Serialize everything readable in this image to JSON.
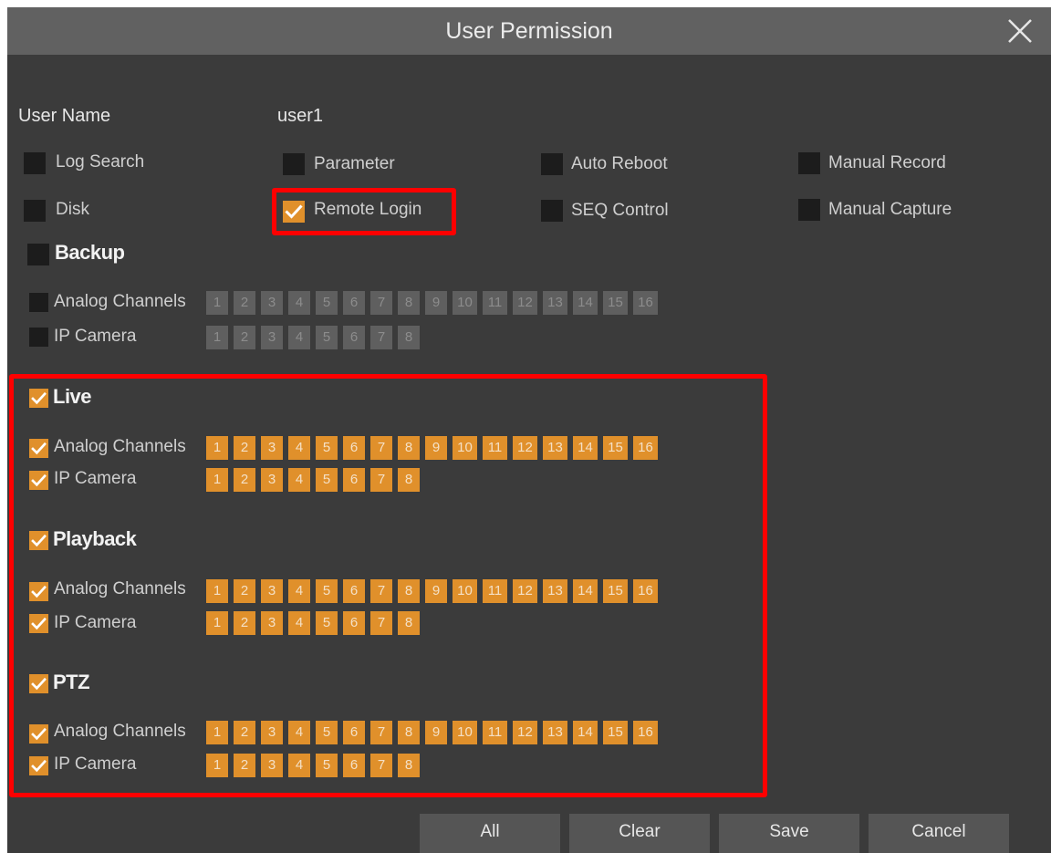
{
  "dialog": {
    "title": "User Permission"
  },
  "user": {
    "label": "User Name",
    "value": "user1"
  },
  "permissions": {
    "log_search": "Log Search",
    "parameter": "Parameter",
    "auto_reboot": "Auto Reboot",
    "manual_record": "Manual Record",
    "disk": "Disk",
    "remote_login": "Remote Login",
    "seq_control": "SEQ Control",
    "manual_capture": "Manual Capture"
  },
  "permission_states": {
    "log_search": false,
    "parameter": false,
    "auto_reboot": false,
    "manual_record": false,
    "disk": false,
    "remote_login": true,
    "seq_control": false,
    "manual_capture": false
  },
  "sections": [
    {
      "title": "Backup",
      "checked": false,
      "rows": [
        {
          "label": "Analog Channels",
          "checked": false,
          "channels": [
            "1",
            "2",
            "3",
            "4",
            "5",
            "6",
            "7",
            "8",
            "9",
            "10",
            "11",
            "12",
            "13",
            "14",
            "15",
            "16"
          ],
          "channels_checked": false
        },
        {
          "label": "IP Camera",
          "checked": false,
          "channels": [
            "1",
            "2",
            "3",
            "4",
            "5",
            "6",
            "7",
            "8"
          ],
          "channels_checked": false
        }
      ]
    },
    {
      "title": "Live",
      "checked": true,
      "rows": [
        {
          "label": "Analog Channels",
          "checked": true,
          "channels": [
            "1",
            "2",
            "3",
            "4",
            "5",
            "6",
            "7",
            "8",
            "9",
            "10",
            "11",
            "12",
            "13",
            "14",
            "15",
            "16"
          ],
          "channels_checked": true
        },
        {
          "label": "IP Camera",
          "checked": true,
          "channels": [
            "1",
            "2",
            "3",
            "4",
            "5",
            "6",
            "7",
            "8"
          ],
          "channels_checked": true
        }
      ]
    },
    {
      "title": "Playback",
      "checked": true,
      "rows": [
        {
          "label": "Analog Channels",
          "checked": true,
          "channels": [
            "1",
            "2",
            "3",
            "4",
            "5",
            "6",
            "7",
            "8",
            "9",
            "10",
            "11",
            "12",
            "13",
            "14",
            "15",
            "16"
          ],
          "channels_checked": true
        },
        {
          "label": "IP Camera",
          "checked": true,
          "channels": [
            "1",
            "2",
            "3",
            "4",
            "5",
            "6",
            "7",
            "8"
          ],
          "channels_checked": true
        }
      ]
    },
    {
      "title": "PTZ",
      "checked": true,
      "rows": [
        {
          "label": "Analog Channels",
          "checked": true,
          "channels": [
            "1",
            "2",
            "3",
            "4",
            "5",
            "6",
            "7",
            "8",
            "9",
            "10",
            "11",
            "12",
            "13",
            "14",
            "15",
            "16"
          ],
          "channels_checked": true
        },
        {
          "label": "IP Camera",
          "checked": true,
          "channels": [
            "1",
            "2",
            "3",
            "4",
            "5",
            "6",
            "7",
            "8"
          ],
          "channels_checked": true
        }
      ]
    }
  ],
  "buttons": {
    "all": "All",
    "clear": "Clear",
    "save": "Save",
    "cancel": "Cancel"
  },
  "colors": {
    "accent": "#e0902b",
    "highlight": "#ff0000",
    "panel": "#3b3b3b",
    "titlebar": "#616161"
  },
  "icons": {
    "close": "close-icon",
    "check": "checkmark-icon"
  }
}
